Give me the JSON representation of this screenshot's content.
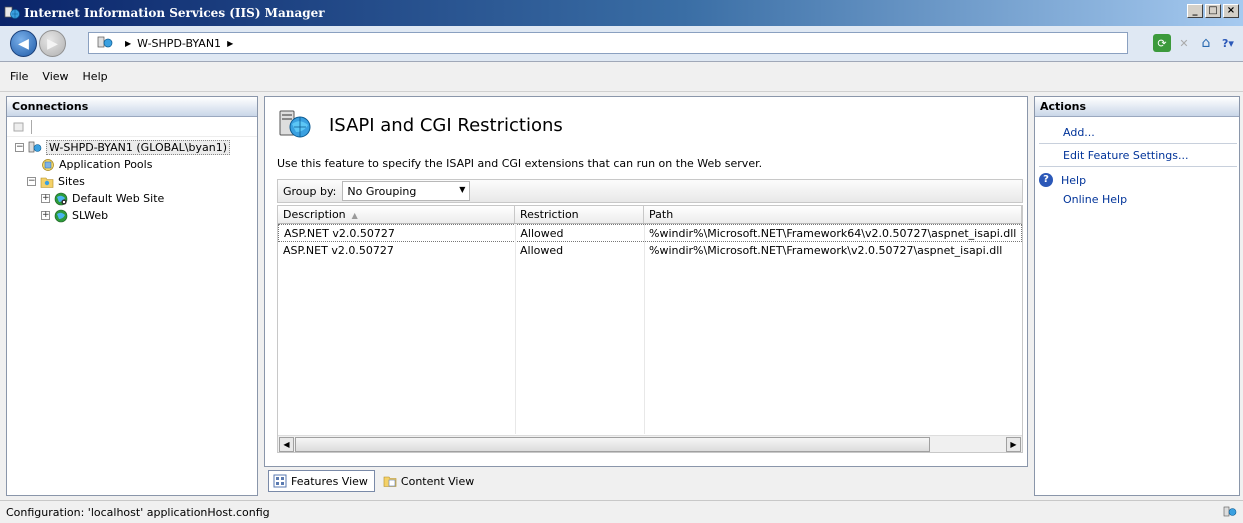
{
  "window": {
    "title": "Internet Information Services (IIS) Manager",
    "buttons": {
      "minimize": "_",
      "maximize": "□",
      "close": "×"
    }
  },
  "address": {
    "crumbs": [
      "W-SHPD-BYAN1"
    ]
  },
  "menu": {
    "items": [
      "File",
      "View",
      "Help"
    ]
  },
  "connections": {
    "header": "Connections",
    "tree": {
      "server": "W-SHPD-BYAN1 (GLOBAL\\byan1)",
      "app_pools": "Application Pools",
      "sites": "Sites",
      "site1": "Default Web Site",
      "site2": "SLWeb"
    }
  },
  "feature": {
    "title": "ISAPI and CGI Restrictions",
    "description": "Use this feature to specify the ISAPI and CGI extensions that can run on the Web server.",
    "group_by_label": "Group by:",
    "group_by_value": "No Grouping",
    "columns": [
      "Description",
      "Restriction",
      "Path"
    ],
    "rows": [
      {
        "description": "ASP.NET v2.0.50727",
        "restriction": "Allowed",
        "path": "%windir%\\Microsoft.NET\\Framework64\\v2.0.50727\\aspnet_isapi.dll"
      },
      {
        "description": "ASP.NET v2.0.50727",
        "restriction": "Allowed",
        "path": "%windir%\\Microsoft.NET\\Framework\\v2.0.50727\\aspnet_isapi.dll"
      }
    ]
  },
  "views": {
    "features": "Features View",
    "content": "Content View"
  },
  "actions": {
    "header": "Actions",
    "add": "Add...",
    "edit": "Edit Feature Settings...",
    "help": "Help",
    "online_help": "Online Help"
  },
  "status": {
    "text": "Configuration: 'localhost' applicationHost.config"
  },
  "colors": {
    "title_start": "#0a246a",
    "title_end": "#a6caf0",
    "link": "#003399"
  }
}
